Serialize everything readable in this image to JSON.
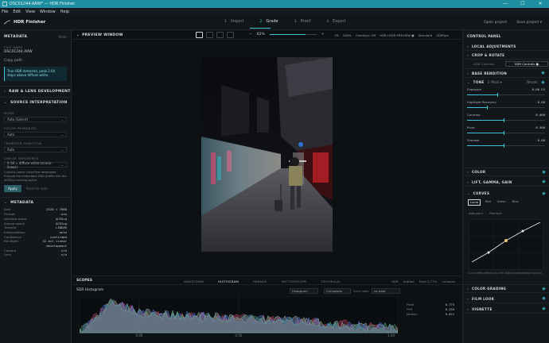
{
  "titlebar": {
    "title": "DSC01244.ARW* — HDR Finisher",
    "min": "—",
    "max": "☐",
    "close": "✕"
  },
  "menubar": {
    "items": [
      "File",
      "Edit",
      "View",
      "Window",
      "Help"
    ]
  },
  "toolbar": {
    "brand": "HDR Finisher",
    "tabs": [
      {
        "num": "1",
        "label": "Import"
      },
      {
        "num": "2",
        "label": "Grade"
      },
      {
        "num": "3",
        "label": "Proof"
      },
      {
        "num": "4",
        "label": "Export"
      }
    ],
    "open_project": "Open project",
    "save_project": "Save project ▾"
  },
  "left": {
    "metadata_head": "METADATA",
    "hide": "Hide",
    "file_name_label": "FILE NAME",
    "file_name": "DSC01244.ARW",
    "copy_path": "Copy path",
    "info": "True HDR detected, peak 2.64 stops above diffuse white.",
    "raw_head": "RAW & LENS DEVELOPMENT",
    "source_head": "SOURCE INTERPRETATION",
    "mode_label": "MODE",
    "mode_value": "Auto (Select)",
    "primaries_label": "COLOR PRIMARIES",
    "primaries_value": "Auto",
    "transfer_label": "TRANSFER FUNCTION",
    "transfer_value": "Auto",
    "linear_label": "LINEAR REFERENCE",
    "linear_value": "0.18 = diffuse white (scene-linear)",
    "note": "Camera-native ColorFlow developed through the embedded DNG profile into the ACEScg working space.",
    "apply": "Apply",
    "reset": "Reset to auto",
    "metadata2_head": "METADATA",
    "rows": [
      {
        "k": "Size",
        "v": "5328 × 7968"
      },
      {
        "k": "Format",
        "v": ".arw"
      },
      {
        "k": "Working space",
        "v": "ACEScg"
      },
      {
        "k": "Source space",
        "v": "ACEScg"
      },
      {
        "k": "Transfer",
        "v": "LINEAR"
      },
      {
        "k": "Interpretation",
        "v": "auto"
      },
      {
        "k": "Confidence",
        "v": "confirmed"
      },
      {
        "k": "Bit depth",
        "v": "32-bit linear"
      },
      {
        "k": "",
        "v": "development"
      },
      {
        "k": "Camera",
        "v": "n/a"
      },
      {
        "k": "Lens",
        "v": "n/a"
      }
    ]
  },
  "center": {
    "preview_title": "PREVIEW WINDOW",
    "zoom_minus": "−",
    "zoom": "62%",
    "zoom_plus": "+",
    "fit": "Fit",
    "fit100": "100%",
    "overlays": "Overlays: Off",
    "hdr_state": "HDR+SDR PREVIEW ●",
    "standard": "Standard",
    "sdr": "SDRSpx"
  },
  "scopes": {
    "title": "SCOPES",
    "tabs": [
      "WAVEFORM",
      "HISTOGRAM",
      "PARADE",
      "VECTORSCOPE",
      "TECHNICAL"
    ],
    "right": [
      "HDR",
      "Settled",
      "Peak 0.77%",
      "Collapse"
    ],
    "histo_title": "SDR Histogram",
    "sel1": "Histogram",
    "sel2": "Composite",
    "scale_label": "Scale label",
    "sel3": "no data",
    "x_ticks": [
      "0.05",
      "0.50",
      "1.00"
    ],
    "stats": [
      {
        "k": "Peak",
        "v": "0.775"
      },
      {
        "k": "P99",
        "v": "0.335"
      },
      {
        "k": "Median",
        "v": "0.021"
      }
    ]
  },
  "right": {
    "head": "CONTROL PANEL",
    "local": "LOCAL ADJUSTMENTS",
    "crop": "CROP & ROTATE",
    "sub_tabs": [
      "HDR Controls",
      "SDR Controls ●"
    ],
    "base": "BASE RENDITION",
    "tone": "TONE",
    "tone_mode": "1 Mod ▾",
    "reset": "Reset",
    "sliders": [
      {
        "label": "Exposure",
        "value": "0.00 EV",
        "frac": 0.78
      },
      {
        "label": "Highlight Recovery",
        "value": "0.00",
        "frac": 0.5
      },
      {
        "label": "Contrast",
        "value": "0.000",
        "frac": 0.94
      },
      {
        "label": "Pivot",
        "value": "0.500",
        "frac": 0.94
      },
      {
        "label": "Shadow",
        "value": "0.00",
        "frac": 0.94
      }
    ],
    "color": "COLOR",
    "lift": "LIFT, GAMMA, GAIN",
    "curves": "CURVES",
    "chips": [
      "Luma",
      "Red",
      "Green",
      "Blue"
    ],
    "add_point": "Add point",
    "remove": "Remove",
    "curve_note": "Curve edits affect only the SDR preview/export branch.",
    "color_grading": "COLOR GRADING",
    "film_look": "FILM LOOK",
    "vignette": "VIGNETTE"
  }
}
